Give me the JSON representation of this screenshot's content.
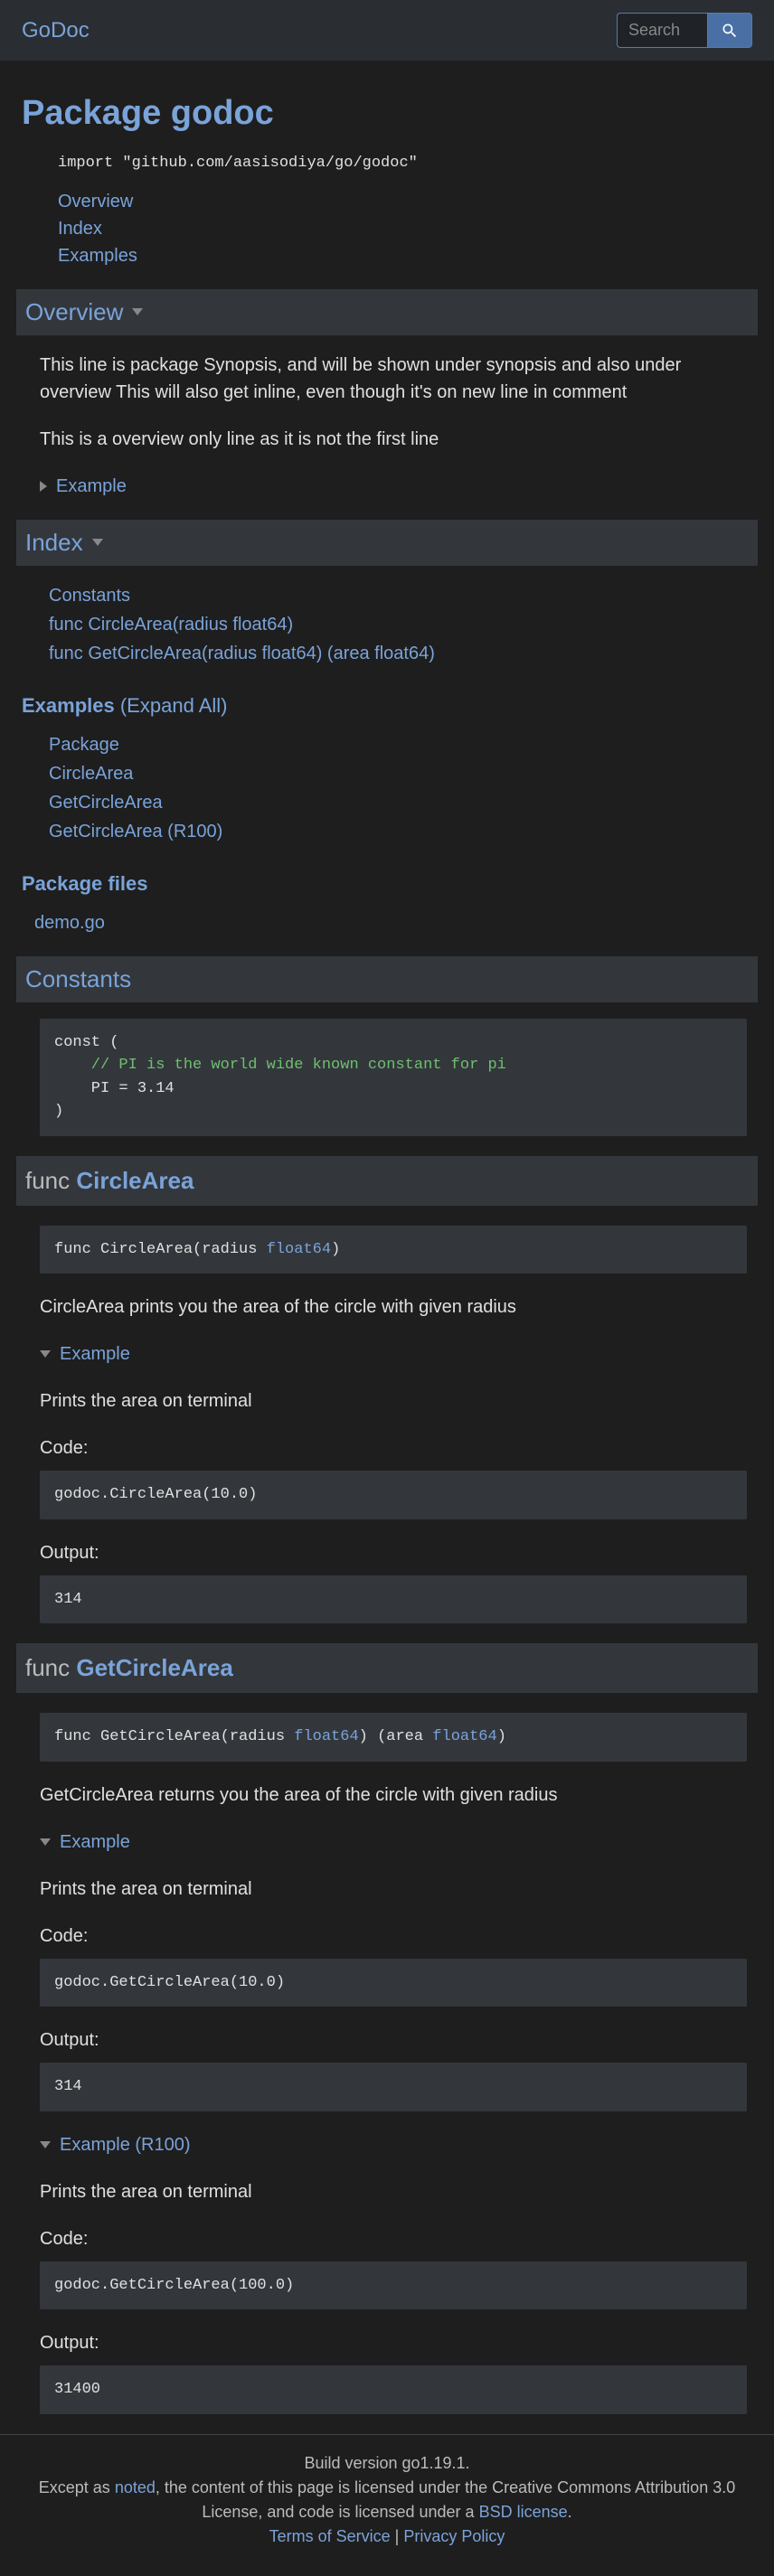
{
  "brand": "GoDoc",
  "search": {
    "placeholder": "Search"
  },
  "title": "Package godoc",
  "import_stmt": "import \"github.com/aasisodiya/go/godoc\"",
  "toc": {
    "overview": "Overview",
    "index": "Index",
    "examples": "Examples"
  },
  "overview": {
    "heading": "Overview",
    "p1": "This line is package Synopsis, and will be shown under synopsis and also under overview This will also get inline, even though it's on new line in comment",
    "p2": "This is a overview only line as it is not the first line",
    "example_label": "Example"
  },
  "index": {
    "heading": "Index",
    "items": {
      "constants": "Constants",
      "circleArea": "func CircleArea(radius float64)",
      "getCircleArea": "func GetCircleArea(radius float64) (area float64)"
    },
    "examples_heading": "Examples",
    "expand_all": "(Expand All)",
    "examples": {
      "package": "Package",
      "circleArea": "CircleArea",
      "getCircleArea": "GetCircleArea",
      "getCircleAreaR100": "GetCircleArea (R100)"
    },
    "files_heading": "Package files",
    "files": {
      "demo": "demo.go"
    }
  },
  "constants": {
    "heading": "Constants",
    "code_l1": "const (",
    "code_l2": "    // PI is the world wide known constant for pi",
    "code_l3": "    PI = 3.14",
    "code_l4": ")"
  },
  "func1": {
    "prefix": "func ",
    "name": "CircleArea",
    "sig_pre": "func CircleArea(radius ",
    "sig_type": "float64",
    "sig_post": ")",
    "desc": "CircleArea prints you the area of the circle with given radius",
    "example_label": "Example",
    "ex_desc": "Prints the area on terminal",
    "code_label": "Code:",
    "code": "godoc.CircleArea(10.0)",
    "output_label": "Output:",
    "output": "314"
  },
  "func2": {
    "prefix": "func ",
    "name": "GetCircleArea",
    "sig_pre": "func GetCircleArea(radius ",
    "sig_t1": "float64",
    "sig_mid": ") (area ",
    "sig_t2": "float64",
    "sig_post": ")",
    "desc": "GetCircleArea returns you the area of the circle with given radius",
    "ex1_label": "Example",
    "ex1_desc": "Prints the area on terminal",
    "ex1_code_label": "Code:",
    "ex1_code": "godoc.GetCircleArea(10.0)",
    "ex1_output_label": "Output:",
    "ex1_output": "314",
    "ex2_label": "Example (R100)",
    "ex2_desc": "Prints the area on terminal",
    "ex2_code_label": "Code:",
    "ex2_code": "godoc.GetCircleArea(100.0)",
    "ex2_output_label": "Output:",
    "ex2_output": "31400"
  },
  "footer": {
    "build": "Build version go1.19.1.",
    "l2a": "Except as ",
    "noted": "noted",
    "l2b": ", the content of this page is licensed under the Creative Commons Attribution 3.0 License, and code is licensed under a ",
    "bsd": "BSD license",
    "l2c": ".",
    "tos": "Terms of Service",
    "sep": " | ",
    "privacy": "Privacy Policy"
  }
}
